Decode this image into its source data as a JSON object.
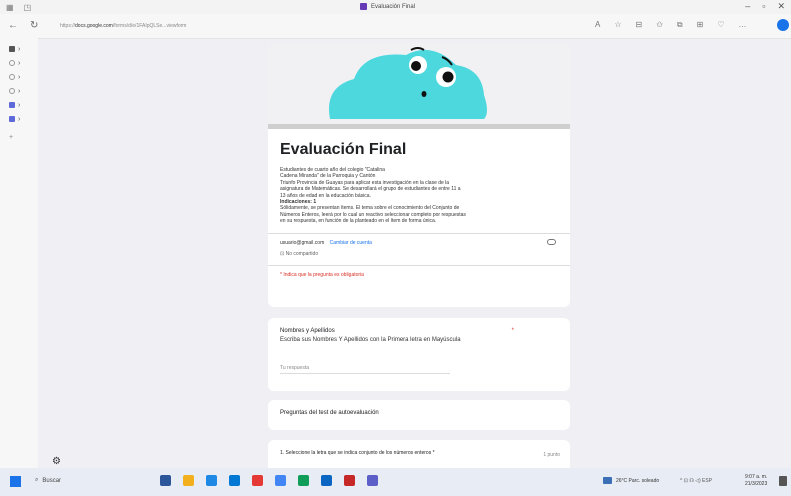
{
  "browser": {
    "tab_title": "Evaluación Final",
    "url_prefix": "https://",
    "url_domain": "docs.google.com",
    "url_rest": "/forms/d/e/1FAIpQLSe...viewform"
  },
  "form": {
    "title": "Evaluación Final",
    "description": [
      {
        "text": "Estudiantes de cuarto año del colegio \"Catalina",
        "bold": false
      },
      {
        "text": "Cadena Miranda\" de la Parroquia y Cantón",
        "bold": false
      },
      {
        "text": "Triunfo Provincia de Guayas para aplicar esta investigación en la clase de la",
        "bold": false
      },
      {
        "text": "asignatura de Matemáticas. Se desarrollará el grupo de estudiantes de entre 11 a",
        "bold": false
      },
      {
        "text": "13 años de edad en la educación básica.",
        "bold": false
      },
      {
        "text": "Indicaciones: 1",
        "bold": true
      },
      {
        "text": "Sólidamente, se presentan ítems. El tema sobre el conocimiento del Conjunto de",
        "bold": false
      },
      {
        "text": "Números Enteros, leerá por lo cual un reactivo seleccionar completo por respuestas",
        "bold": false
      },
      {
        "text": "en su respuesta, en función de la planteado en el ítem de forma única.",
        "bold": false
      }
    ],
    "email": "usuario@gmail.com",
    "switch_account": "Cambiar de cuenta",
    "not_shared": "No compartido",
    "required_note": "* Indica que la pregunta es obligatoria"
  },
  "question1": {
    "title": "Nombres y Apellidos",
    "required_mark": "*",
    "description": "Escriba sus Nombres Y Apellidos con la Primera letra en Mayúscula",
    "placeholder": "Tu respuesta"
  },
  "section": {
    "title": "Preguntas del test de autoevaluación"
  },
  "question2": {
    "title": "1. Seleccione la letra que se indica conjunto de los números enteros *",
    "points": "1 punto"
  },
  "taskbar": {
    "search_label": "Buscar",
    "weather": "26°C Parc. soleado",
    "tray": "^ ⊡ ☊ ◁) ESP",
    "time": "9:07 a. m.",
    "date": "21/3/2023",
    "app_colors": [
      "#2b579a",
      "#f2b01e",
      "#1e88e5",
      "#0078d4",
      "#e53935",
      "#4285f4",
      "#0f9d58",
      "#0a66c2",
      "#c62828",
      "#5b5fc7"
    ]
  },
  "colors": {
    "accent": "#673ab7",
    "cloud": "#4dd8de",
    "required": "#d93025",
    "link": "#1a73e8"
  }
}
